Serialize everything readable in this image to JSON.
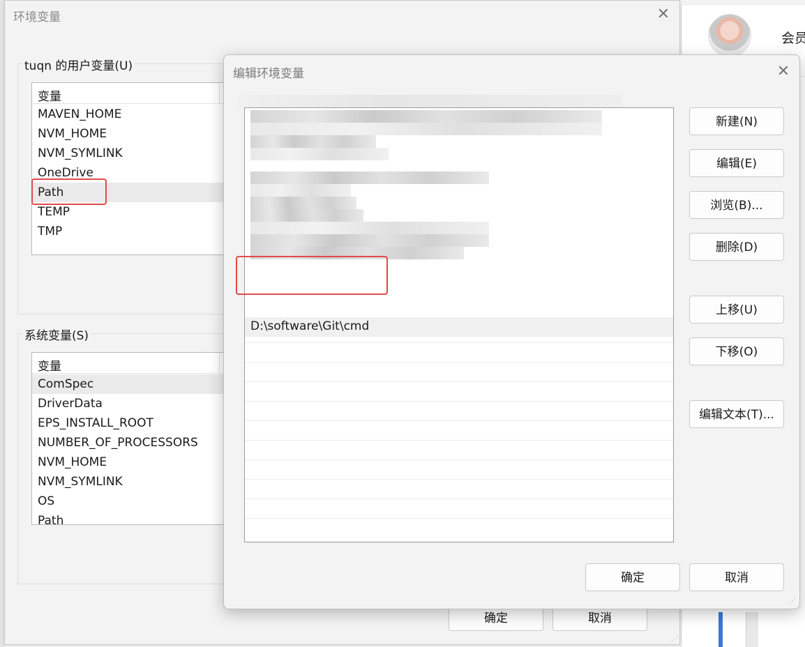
{
  "background_app": {
    "member_text": "会员"
  },
  "env_window": {
    "title": "环境变量",
    "close_icon": "✕",
    "user_group_label": "tuqn 的用户变量(U)",
    "user_list_header": "变量",
    "user_vars": [
      "MAVEN_HOME",
      "NVM_HOME",
      "NVM_SYMLINK",
      "OneDrive",
      "Path",
      "TEMP",
      "TMP"
    ],
    "system_group_label": "系统变量(S)",
    "system_list_header": "变量",
    "system_vars": [
      "ComSpec",
      "DriverData",
      "EPS_INSTALL_ROOT",
      "NUMBER_OF_PROCESSORS",
      "NVM_HOME",
      "NVM_SYMLINK",
      "OS",
      "Path"
    ],
    "ok_label": "确定",
    "cancel_label": "取消"
  },
  "edit_dialog": {
    "title": "编辑环境变量",
    "close_icon": "✕",
    "visible_entry": "D:\\software\\Git\\cmd",
    "buttons": {
      "new": "新建(N)",
      "edit": "编辑(E)",
      "browse": "浏览(B)...",
      "delete": "删除(D)",
      "move_up": "上移(U)",
      "move_down": "下移(O)",
      "edit_text": "编辑文本(T)..."
    },
    "ok_label": "确定",
    "cancel_label": "取消"
  },
  "colors": {
    "highlight_box": "#e04a4a",
    "window_bg": "#f3f3f3",
    "list_bg": "#ffffff"
  }
}
